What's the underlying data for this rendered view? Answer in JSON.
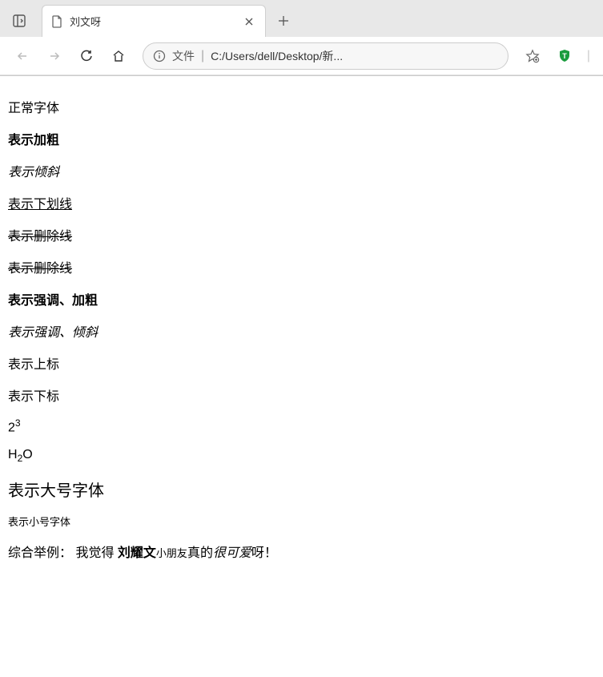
{
  "browser": {
    "tab": {
      "title": "刘文呀"
    },
    "address": {
      "file_label": "文件",
      "url": "C:/Users/dell/Desktop/新..."
    }
  },
  "content": {
    "line1": "正常字体",
    "line2": "表示加粗",
    "line3": "表示倾斜",
    "line4": "表示下划线",
    "line5": "表示删除线",
    "line6": "表示删除线",
    "line7": "表示强调、加粗",
    "line8": "表示强调、倾斜",
    "line9": "表示上标",
    "line10": "表示下标",
    "sup_example": {
      "base": "2",
      "sup": "3"
    },
    "sub_example": {
      "pre": "H",
      "sub": "2",
      "post": "O"
    },
    "big": "表示大号字体",
    "small": "表示小号字体",
    "combined": {
      "prefix": "综合举例：   我觉得 ",
      "bold": "刘耀文",
      "small": "小朋友",
      "mid": "真的",
      "italic": "很可爱",
      "suffix": "呀！"
    }
  }
}
